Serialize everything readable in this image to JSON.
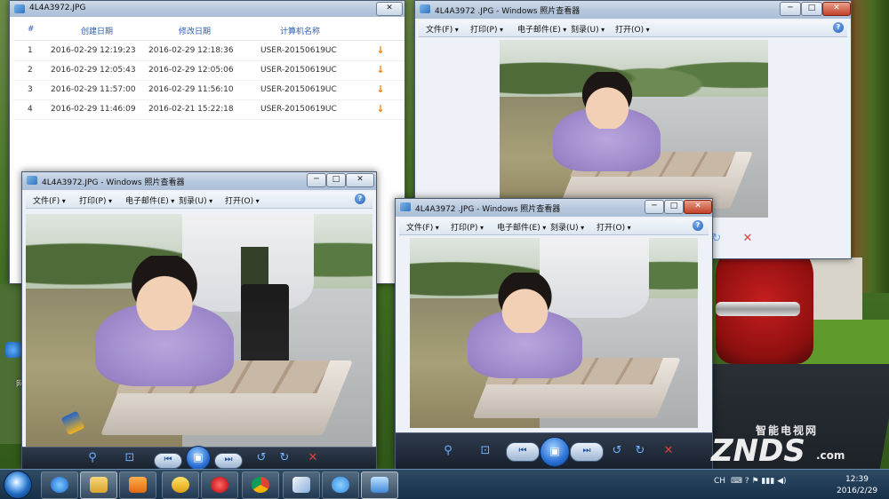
{
  "list_window": {
    "title": "4L4A3972.JPG",
    "columns": [
      "#",
      "创建日期",
      "修改日期",
      "计算机名称"
    ],
    "rows": [
      {
        "index": "1",
        "created": "2016-02-29 12:19:23",
        "modified": "2016-02-29 12:18:36",
        "computer": "USER-20150619UC"
      },
      {
        "index": "2",
        "created": "2016-02-29 12:05:43",
        "modified": "2016-02-29 12:05:06",
        "computer": "USER-20150619UC"
      },
      {
        "index": "3",
        "created": "2016-02-29 11:57:00",
        "modified": "2016-02-29 11:56:10",
        "computer": "USER-20150619UC"
      },
      {
        "index": "4",
        "created": "2016-02-29 11:46:09",
        "modified": "2016-02-21 15:22:18",
        "computer": "USER-20150619UC"
      }
    ],
    "download_icon": "download-arrow-icon",
    "accent_color": "#f0840e"
  },
  "viewer_back": {
    "title": "4L4A3972 .JPG - Windows 照片查看器"
  },
  "viewer_left": {
    "title": "4L4A3972.JPG - Windows 照片查看器"
  },
  "viewer_front": {
    "title": "4L4A3972 .JPG - Windows 照片查看器"
  },
  "viewer_menu": {
    "file": "文件(F)",
    "print": "打印(P)",
    "email": "电子邮件(E)",
    "burn": "刻录(U)",
    "open": "打开(O)",
    "help": "?"
  },
  "window_controls": {
    "minimize": "─",
    "maximize": "□",
    "close": "✕"
  },
  "viewer_toolbar": {
    "zoom": "⚲",
    "fit": "⊡",
    "prev": "⏮",
    "slideshow": "▣",
    "next": "⏭",
    "rotate_ccw": "↺",
    "rotate_cw": "↻",
    "delete": "✕"
  },
  "taskbar": {
    "apps": [
      "start-orb",
      "internet-explorer",
      "file-explorer",
      "media-player",
      "aim-app",
      "opera-browser",
      "chrome-browser",
      "paint-app",
      "cloud-app",
      "photo-viewer"
    ],
    "tray_lang": "CH",
    "tray_icons": "⌨ ? ⚑ ▮▮▮ ◀)",
    "time": "12:39",
    "date": "2016/2/29"
  },
  "watermark": {
    "cn": "智能电视网",
    "brand": "ZNDS",
    "domain": ".com"
  },
  "desktop": {
    "labels": [
      "网"
    ]
  }
}
